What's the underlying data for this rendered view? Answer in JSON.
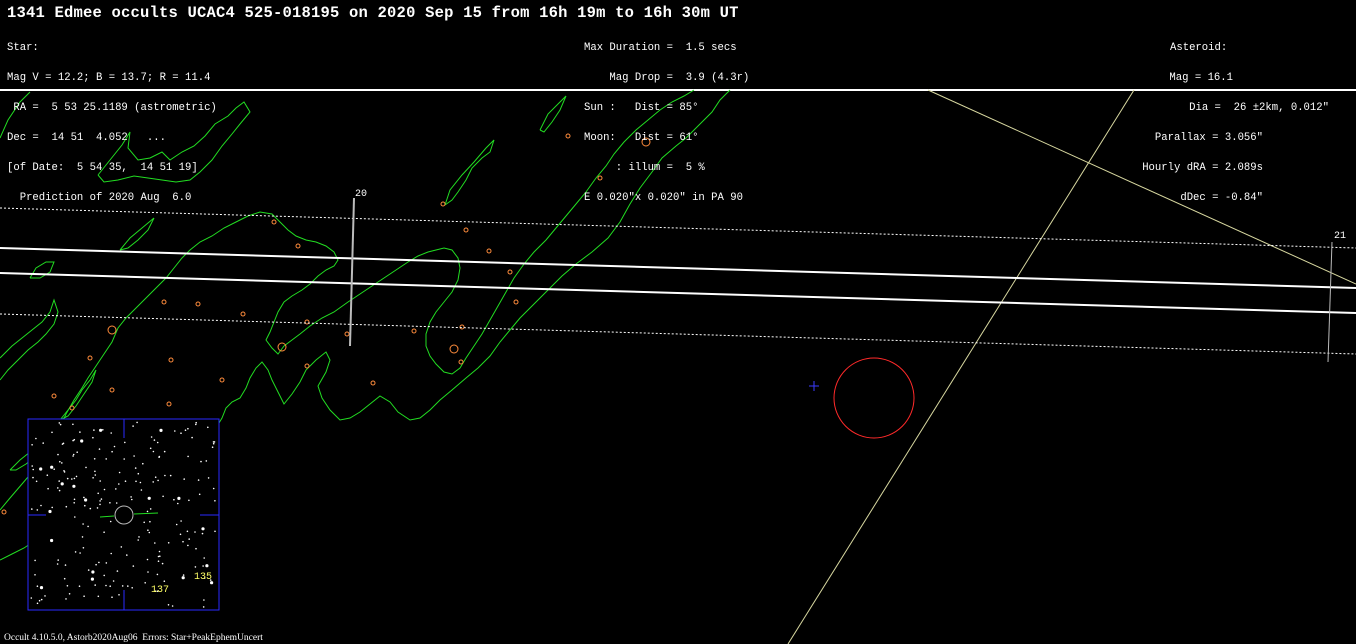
{
  "title": "1341 Edmee occults UCAC4 525-018195 on 2020 Sep 15 from 16h 19m to 16h 30m UT",
  "star_block": [
    "Star:",
    "Mag V = 12.2; B = 13.7; R = 11.4",
    " RA =  5 53 25.1189 (astrometric)",
    "Dec =  14 51  4.052   ...",
    "[of Date:  5 54 35,  14 51 19]",
    "  Prediction of 2020 Aug  6.0"
  ],
  "event_block": [
    "Max Duration =  1.5 secs",
    "    Mag Drop =  3.9 (4.3r)",
    "Sun :   Dist = 85°",
    "Moon:   Dist = 61°",
    "     : illum =  5 %",
    "E 0.020\"x 0.020\" in PA 90"
  ],
  "asteroid_block": [
    "Asteroid:",
    "Mag = 16.1",
    "Dia =  26 ±2km, 0.012\"",
    "Parallax = 3.056\"",
    "Hourly dRA = 2.089s",
    "dDec = -0.84\""
  ],
  "time_markers": [
    "20",
    "21"
  ],
  "finder_labels": [
    "137",
    "135"
  ],
  "footer": "Occult 4.10.5.0, Astorb2020Aug06  Errors: Star+PeakEphemUncert",
  "colors": {
    "background": "#000000",
    "text": "#ffffff",
    "coastline": "#22dd22",
    "city": "#ff8c3c",
    "path": "#ffffff",
    "sun_line": "#d8d8a0",
    "finder_frame": "#2a2aff",
    "asteroid_circle": "#ff2a2a",
    "marker_cross": "#3b3bff",
    "finder_label": "#ffff66"
  }
}
